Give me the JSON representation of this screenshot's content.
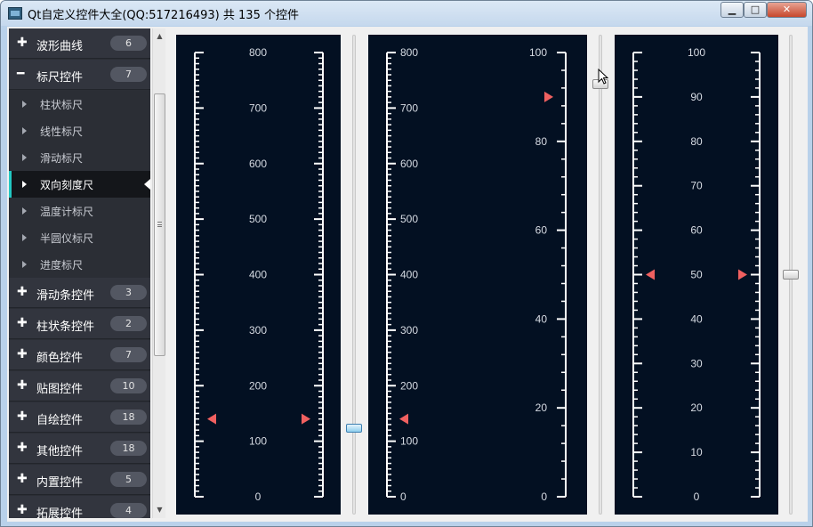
{
  "window": {
    "title": "Qt自定义控件大全(QQ:517216493) 共 135 个控件",
    "minimize_glyph": "▁",
    "maximize_glyph": "□",
    "close_glyph": "✕"
  },
  "nav": {
    "plus_glyph": "✚",
    "minus_glyph": "━",
    "groups": [
      {
        "label": "波形曲线",
        "count": "6",
        "expanded": false
      },
      {
        "label": "标尺控件",
        "count": "7",
        "expanded": true
      },
      {
        "label": "滑动条控件",
        "count": "3",
        "expanded": false
      },
      {
        "label": "柱状条控件",
        "count": "2",
        "expanded": false
      },
      {
        "label": "颜色控件",
        "count": "7",
        "expanded": false
      },
      {
        "label": "贴图控件",
        "count": "10",
        "expanded": false
      },
      {
        "label": "自绘控件",
        "count": "18",
        "expanded": false
      },
      {
        "label": "其他控件",
        "count": "18",
        "expanded": false
      },
      {
        "label": "内置控件",
        "count": "5",
        "expanded": false
      },
      {
        "label": "拓展控件",
        "count": "4",
        "expanded": false
      }
    ],
    "children": [
      "柱状标尺",
      "线性标尺",
      "滑动标尺",
      "双向刻度尺",
      "温度计标尺",
      "半圆仪标尺",
      "进度标尺"
    ],
    "active_child": "双向刻度尺"
  },
  "scrollbar": {
    "up_glyph": "▲",
    "down_glyph": "▼"
  },
  "rulers": [
    {
      "min": 0,
      "max": 800,
      "major_step": 100,
      "minor_per_major": 10,
      "value": 140,
      "left_scale": true,
      "right_scale": true,
      "labels_side": "center",
      "left_marker": true,
      "right_marker": true,
      "bg_color": "#031022",
      "scale_color": "#ffffff",
      "marker_color": "#f06060"
    },
    {
      "min": 0,
      "max": 800,
      "major_step": 100,
      "minor_per_major": 10,
      "value": 140,
      "left_scale": true,
      "right_scale": false,
      "labels_side": "left-inner",
      "left_marker": true,
      "right_marker": false,
      "bg_color": "#031022",
      "scale_color": "#ffffff",
      "marker_color": "#f06060"
    },
    {
      "min": 0,
      "max": 100,
      "major_step": 20,
      "minor_per_major": 5,
      "value": 90,
      "left_scale": false,
      "right_scale": true,
      "labels_side": "right-inner",
      "left_marker": false,
      "right_marker": true,
      "bg_color": "#031022",
      "scale_color": "#ffffff",
      "marker_color": "#f06060"
    },
    {
      "min": 0,
      "max": 100,
      "major_step": 10,
      "minor_per_major": 5,
      "value": 50,
      "left_scale": true,
      "right_scale": true,
      "labels_side": "center",
      "left_marker": true,
      "right_marker": true,
      "bg_color": "#031022",
      "scale_color": "#ffffff",
      "marker_color": "#f06060"
    }
  ],
  "sliders": [
    {
      "name": "ruler-1-slider",
      "value": 140,
      "min": 0,
      "max": 800
    },
    {
      "name": "ruler-3-slider",
      "value": 90,
      "min": 0,
      "max": 100
    },
    {
      "name": "ruler-4-slider",
      "value": 50,
      "min": 0,
      "max": 100
    }
  ]
}
